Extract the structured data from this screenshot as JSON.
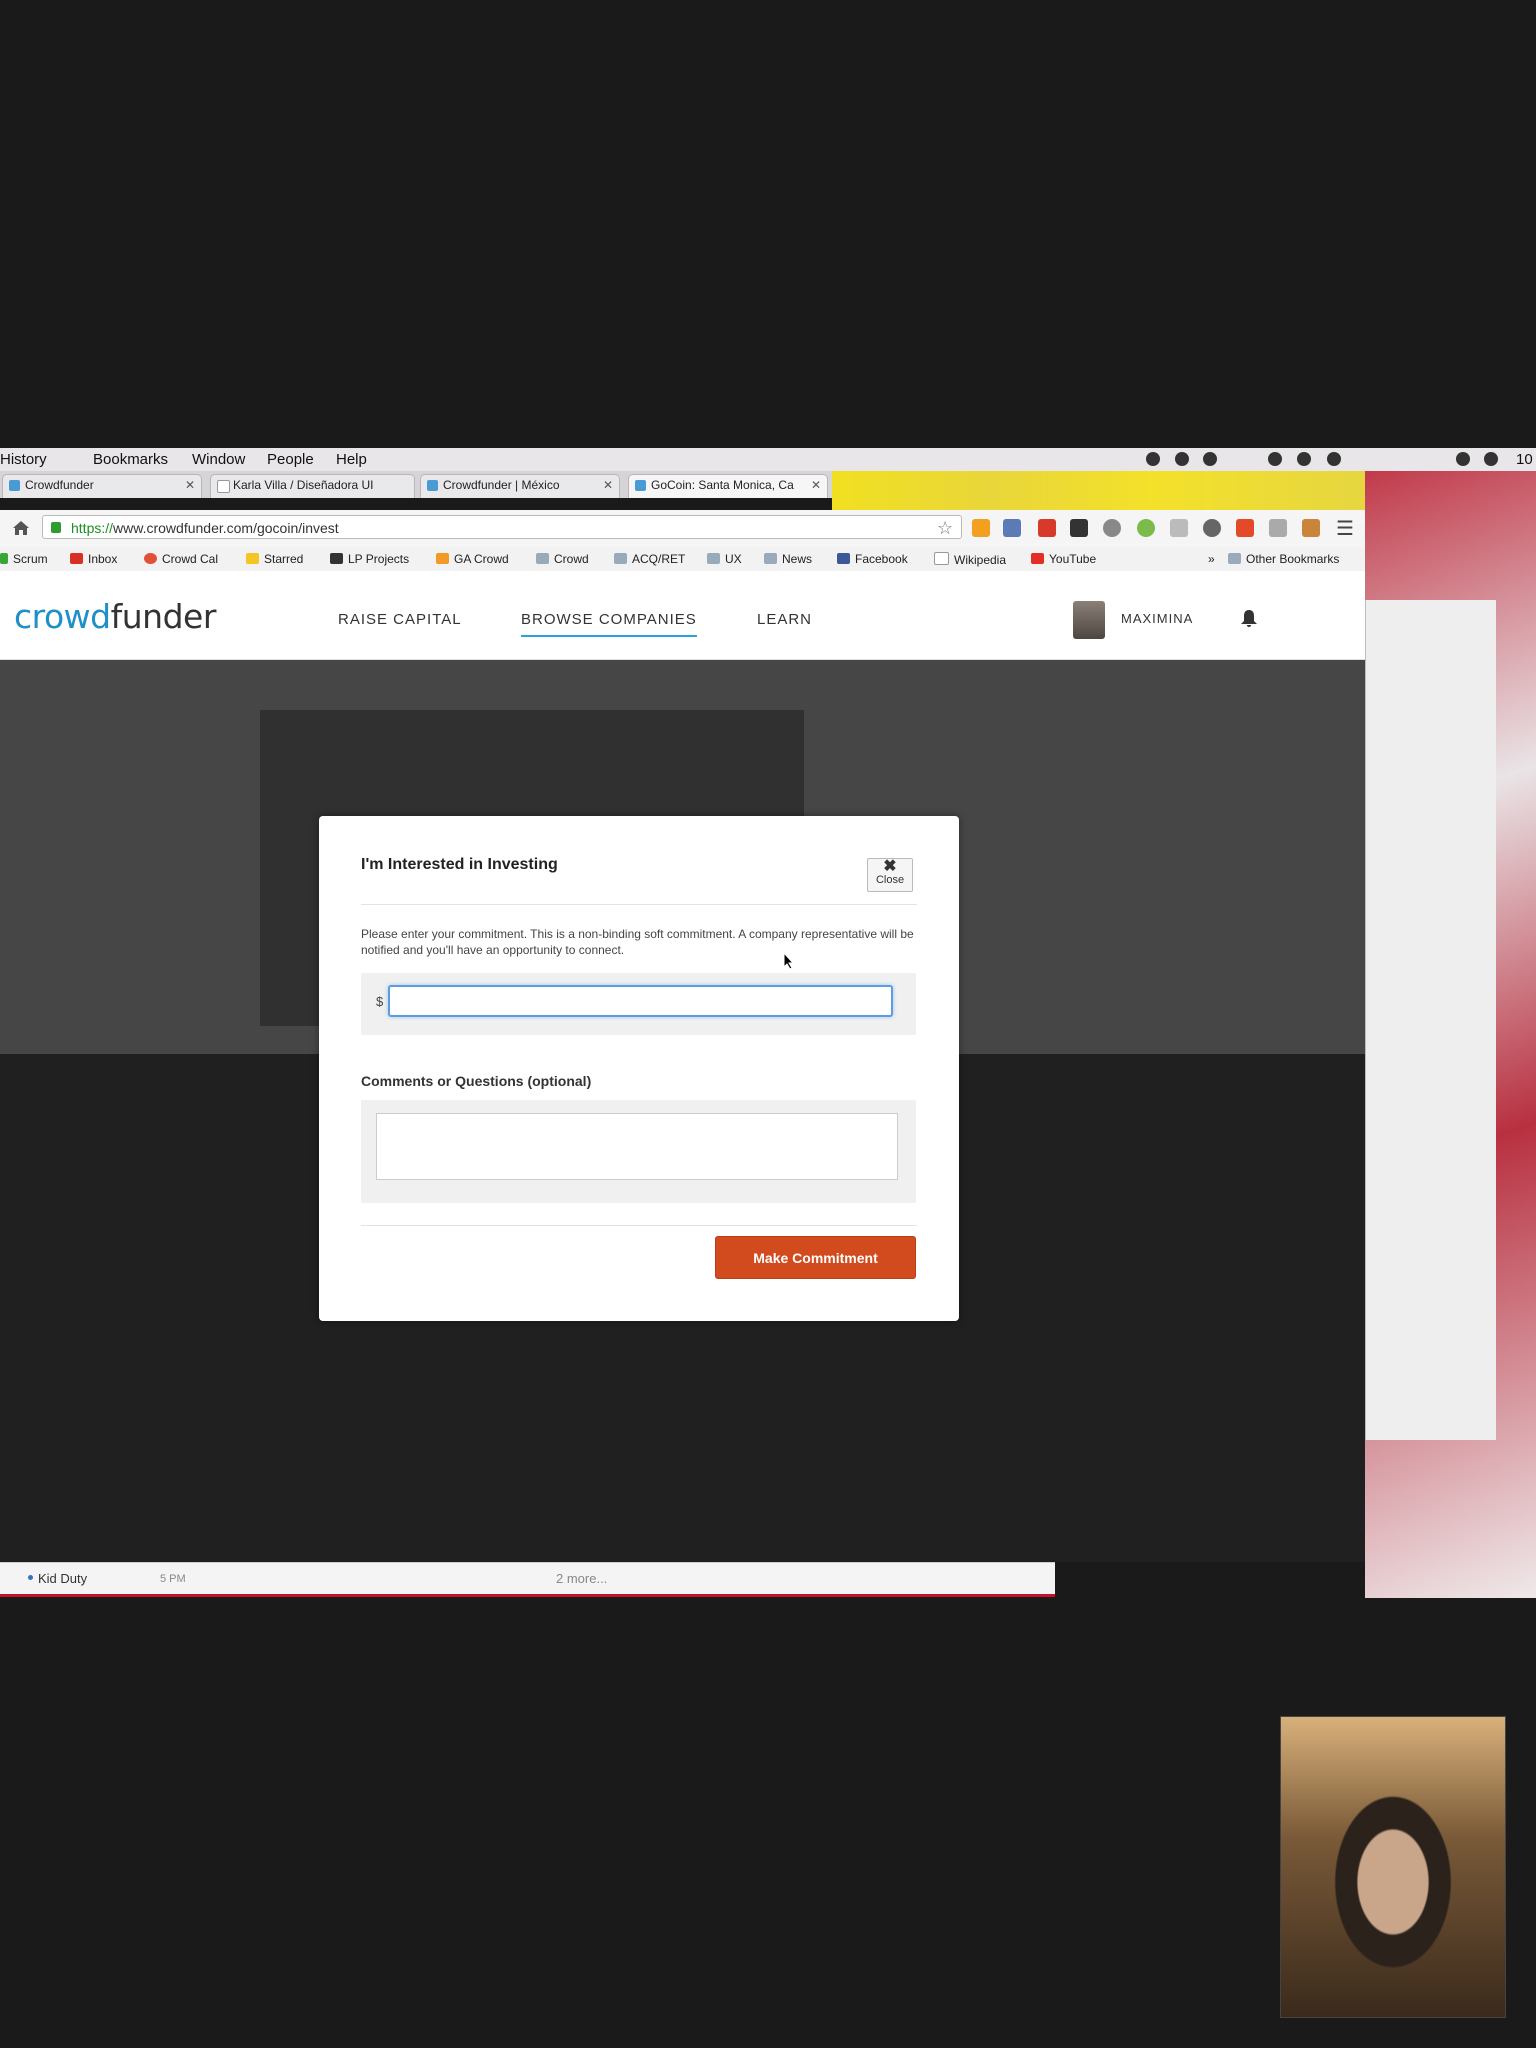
{
  "menubar": {
    "items": [
      "History",
      "Bookmarks",
      "Window",
      "People",
      "Help"
    ],
    "clock": "10"
  },
  "tabs": [
    {
      "label": "Crowdfunder"
    },
    {
      "label": "Karla Villa / Diseñadora UI"
    },
    {
      "label": "Crowdfunder | México"
    },
    {
      "label": "GoCoin: Santa Monica, Ca"
    }
  ],
  "address": {
    "scheme": "https://",
    "rest": "www.crowdfunder.com/gocoin/invest"
  },
  "bookmarks": {
    "items": [
      "Scrum",
      "Inbox",
      "Crowd Cal",
      "Starred",
      "LP Projects",
      "GA Crowd",
      "Crowd",
      "ACQ/RET",
      "UX",
      "News",
      "Facebook",
      "Wikipedia",
      "YouTube"
    ],
    "overflow": "»",
    "other": "Other Bookmarks"
  },
  "site": {
    "logo_a": "crowd",
    "logo_b": "funder",
    "nav": [
      "RAISE CAPITAL",
      "BROWSE COMPANIES",
      "LEARN"
    ],
    "username": "MAXIMINA"
  },
  "modal": {
    "title": "I'm Interested in Investing",
    "close_label": "Close",
    "intro": "Please enter your commitment. This is a non-binding soft commitment. A company representative will be notified and you'll have an opportunity to connect.",
    "currency": "$",
    "amount_value": "",
    "comments_label": "Comments or Questions (optional)",
    "comments_value": "",
    "submit_label": "Make Commitment"
  },
  "calendar": {
    "event": "Kid Duty",
    "time": "5 PM",
    "more": "2 more..."
  },
  "colors": {
    "brand_blue": "#1f8fc9",
    "commit_orange": "#d14b1e",
    "focus_blue": "#5b9de2"
  }
}
